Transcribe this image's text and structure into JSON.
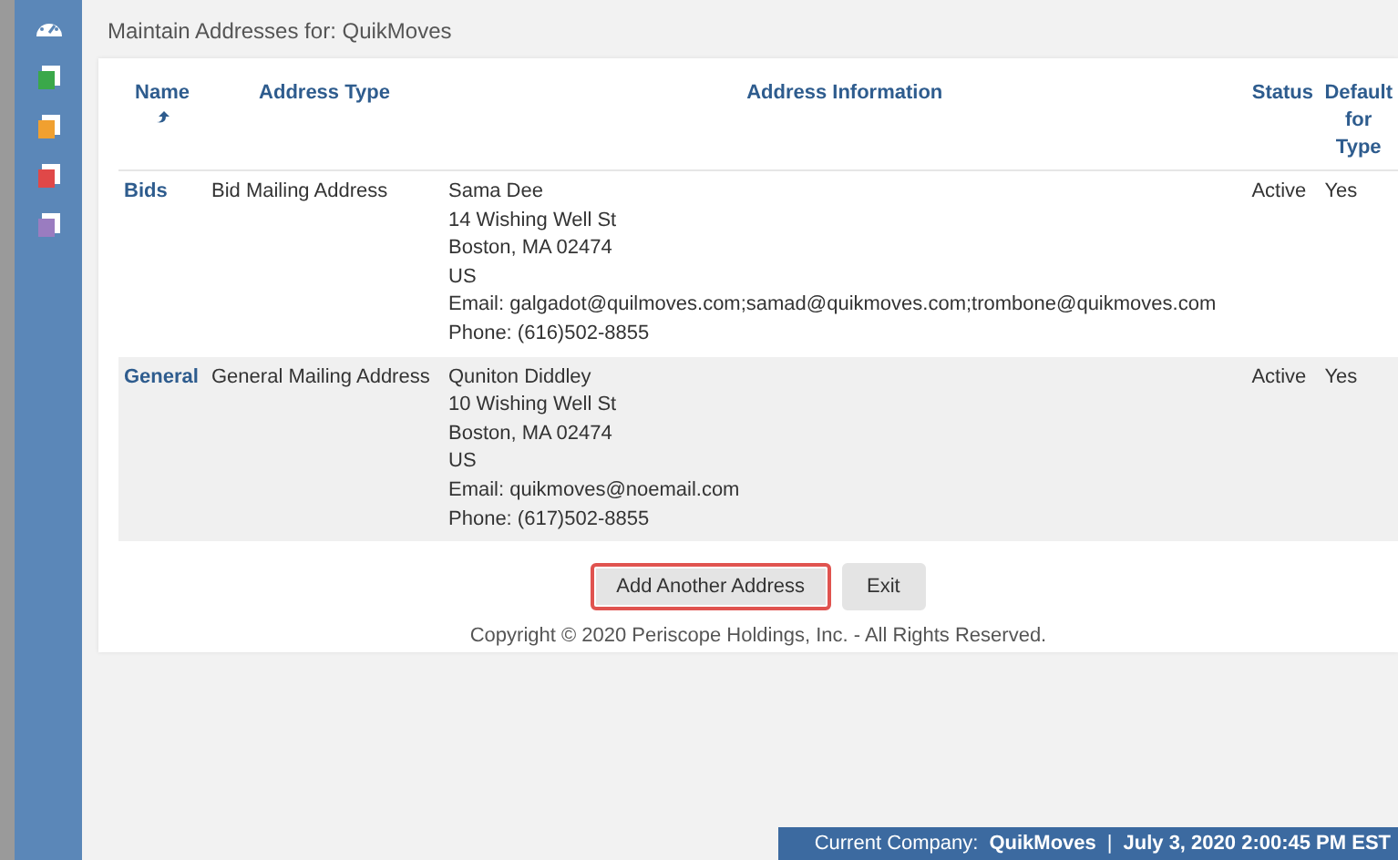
{
  "sidebar": {
    "items": [
      {
        "kind": "gauge"
      },
      {
        "kind": "doc",
        "color": "#3aa84a"
      },
      {
        "kind": "doc",
        "color": "#f0a030"
      },
      {
        "kind": "doc",
        "color": "#e04848"
      },
      {
        "kind": "doc",
        "color": "#9a7cc0"
      }
    ]
  },
  "page_title": "Maintain Addresses for:  QuikMoves",
  "table": {
    "columns": [
      {
        "label": "Name",
        "sortable": true
      },
      {
        "label": "Address Type",
        "sortable": false
      },
      {
        "label": "Address Information",
        "sortable": false
      },
      {
        "label": "Status",
        "sortable": false
      },
      {
        "label": "Default for Type",
        "sortable": false
      }
    ],
    "rows": [
      {
        "name": "Bids",
        "type": "Bid Mailing Address",
        "info": [
          "Sama Dee",
          "14 Wishing Well St",
          "Boston, MA 02474",
          "US",
          "Email: galgadot@quilmoves.com;samad@quikmoves.com;trombone@quikmoves.com",
          "Phone: (616)502-8855"
        ],
        "status": "Active",
        "default": "Yes"
      },
      {
        "name": "General",
        "type": "General Mailing Address",
        "info": [
          "Quniton Diddley",
          "10 Wishing Well St",
          "Boston, MA 02474",
          "US",
          "Email: quikmoves@noemail.com",
          "Phone: (617)502-8855"
        ],
        "status": "Active",
        "default": "Yes"
      }
    ]
  },
  "buttons": [
    {
      "label": "Add Another Address",
      "highlighted": true
    },
    {
      "label": "Exit",
      "highlighted": false
    }
  ],
  "copyright": "Copyright © 2020 Periscope Holdings, Inc. - All Rights Reserved.",
  "status_bar": {
    "company_label": "Current Company:",
    "company": "QuikMoves",
    "separator": "|",
    "datetime": "July 3, 2020 2:00:45 PM EST"
  }
}
